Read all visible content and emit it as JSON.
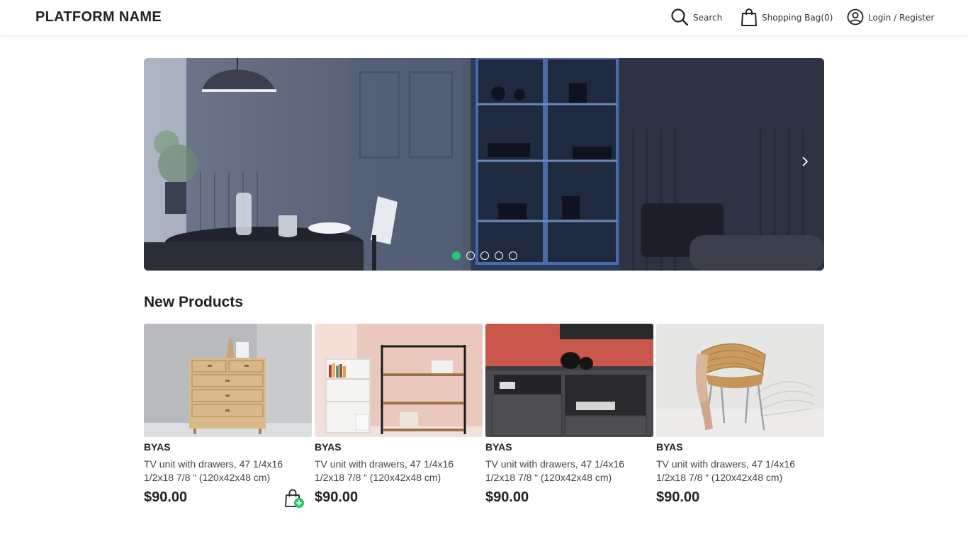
{
  "header": {
    "brand": "PLATFORM NAME",
    "search_label": "Search",
    "bag_label": "Shopping Bag(0)",
    "login_label": "Login / Register"
  },
  "hero": {
    "slide_count": 5,
    "active_slide": 1,
    "accent_color": "#25c76a"
  },
  "section": {
    "title": "New Products"
  },
  "products": [
    {
      "brand": "BYAS",
      "description": "TV unit with drawers, 47 1/4x16 1/2x18 7/8 “ (120x42x48 cm)",
      "price": "$90.00",
      "image": "wooden-chest-of-drawers"
    },
    {
      "brand": "BYAS",
      "description": "TV unit with drawers, 47 1/4x16 1/2x18 7/8 “ (120x42x48 cm)",
      "price": "$90.00",
      "image": "shelving-units"
    },
    {
      "brand": "BYAS",
      "description": "TV unit with drawers, 47 1/4x16 1/2x18 7/8 “ (120x42x48 cm)",
      "price": "$90.00",
      "image": "dark-tv-unit"
    },
    {
      "brand": "BYAS",
      "description": "TV unit with drawers, 47 1/4x16 1/2x18 7/8 “ (120x42x48 cm)",
      "price": "$90.00",
      "image": "rattan-chair"
    }
  ],
  "icons": {
    "search": "search-icon",
    "bag": "shopping-bag-icon",
    "user": "user-icon",
    "next": "chevron-right-icon",
    "add_to_bag": "add-to-bag-icon"
  }
}
